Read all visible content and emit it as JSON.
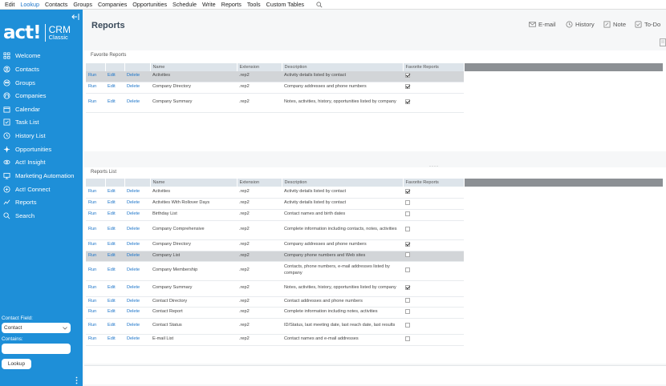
{
  "menu": [
    "Edit",
    "Lookup",
    "Contacts",
    "Groups",
    "Companies",
    "Opportunities",
    "Schedule",
    "Write",
    "Reports",
    "Tools",
    "Custom Tables"
  ],
  "menu_active": 1,
  "logo": {
    "act": "act!",
    "crm": "CRM",
    "classic": "Classic"
  },
  "nav": [
    {
      "label": "Welcome",
      "icon": "home-icon"
    },
    {
      "label": "Contacts",
      "icon": "contacts-icon"
    },
    {
      "label": "Groups",
      "icon": "groups-icon"
    },
    {
      "label": "Companies",
      "icon": "companies-icon"
    },
    {
      "label": "Calendar",
      "icon": "calendar-icon"
    },
    {
      "label": "Task List",
      "icon": "task-list-icon"
    },
    {
      "label": "History List",
      "icon": "history-icon"
    },
    {
      "label": "Opportunities",
      "icon": "opportunities-icon"
    },
    {
      "label": "Act! Insight",
      "icon": "insight-icon"
    },
    {
      "label": "Marketing Automation",
      "icon": "marketing-icon"
    },
    {
      "label": "Act! Connect",
      "icon": "connect-icon"
    },
    {
      "label": "Reports",
      "icon": "reports-icon"
    },
    {
      "label": "Search",
      "icon": "search-icon"
    }
  ],
  "lookup": {
    "field_label": "Contact Field:",
    "field_value": "Contact",
    "contains_label": "Contains:",
    "button": "Lookup"
  },
  "page_title": "Reports",
  "toolbar": {
    "email": "E-mail",
    "history": "History",
    "note": "Note",
    "todo": "To-Do"
  },
  "columns": {
    "c1": "",
    "c2": "",
    "c3": "",
    "name": "Name",
    "ext": "Extension",
    "desc": "Description",
    "fav": "Favorite Reports"
  },
  "favorite": {
    "title": "Favorite Reports",
    "rows": [
      {
        "run": "Run",
        "edit": "Edit",
        "del": "Delete",
        "name": "Activities",
        "ext": ".rep2",
        "desc": "Activity details listed by contact",
        "fav": true,
        "sel": true
      },
      {
        "run": "Run",
        "edit": "Edit",
        "del": "Delete",
        "name": "Company Directory",
        "ext": ".rep2",
        "desc": "Company addresses and phone numbers",
        "fav": true,
        "sel": false
      },
      {
        "run": "Run",
        "edit": "Edit",
        "del": "Delete",
        "name": "Company Summary",
        "ext": ".rep2",
        "desc": "Notes, activities, history, opportunities listed by company",
        "fav": true,
        "sel": false
      }
    ]
  },
  "reports": {
    "title": "Reports List",
    "rows": [
      {
        "run": "Run",
        "edit": "Edit",
        "del": "Delete",
        "name": "Activities",
        "ext": ".rep2",
        "desc": "Activity details listed by contact",
        "fav": true,
        "sel": false
      },
      {
        "run": "Run",
        "edit": "Edit",
        "del": "Delete",
        "name": "Activities With Rollover Days",
        "ext": ".rep2",
        "desc": "Activity details listed by contact",
        "fav": false,
        "sel": false
      },
      {
        "run": "Run",
        "edit": "Edit",
        "del": "Delete",
        "name": "Birthday List",
        "ext": ".rep2",
        "desc": "Contact names and birth dates",
        "fav": false,
        "sel": false
      },
      {
        "run": "Run",
        "edit": "Edit",
        "del": "Delete",
        "name": "Company Comprehensive",
        "ext": ".rep2",
        "desc": "Complete information including contacts, notes, activities",
        "fav": false,
        "sel": false
      },
      {
        "run": "Run",
        "edit": "Edit",
        "del": "Delete",
        "name": "Company Directory",
        "ext": ".rep2",
        "desc": "Company addresses and phone numbers",
        "fav": true,
        "sel": false
      },
      {
        "run": "Run",
        "edit": "Edit",
        "del": "Delete",
        "name": "Company List",
        "ext": ".rep2",
        "desc": "Company phone numbers and Web sites",
        "fav": false,
        "sel": true
      },
      {
        "run": "Run",
        "edit": "Edit",
        "del": "Delete",
        "name": "Company Membership",
        "ext": ".rep2",
        "desc": "Contacts, phone numbers, e-mail addresses listed by company",
        "fav": false,
        "sel": false
      },
      {
        "run": "Run",
        "edit": "Edit",
        "del": "Delete",
        "name": "Company Summary",
        "ext": ".rep2",
        "desc": "Notes, activities, history, opportunities listed by company",
        "fav": true,
        "sel": false
      },
      {
        "run": "Run",
        "edit": "Edit",
        "del": "Delete",
        "name": "Contact Directory",
        "ext": ".rep2",
        "desc": "Contact addresses and phone numbers",
        "fav": false,
        "sel": false
      },
      {
        "run": "Run",
        "edit": "Edit",
        "del": "Delete",
        "name": "Contact Report",
        "ext": ".rep2",
        "desc": "Complete information including notes, activities",
        "fav": false,
        "sel": false
      },
      {
        "run": "Run",
        "edit": "Edit",
        "del": "Delete",
        "name": "Contact Status",
        "ext": ".rep2",
        "desc": "ID/Status, last meeting date, last reach date, last results",
        "fav": false,
        "sel": false
      },
      {
        "run": "Run",
        "edit": "Edit",
        "del": "Delete",
        "name": "E-mail List",
        "ext": ".rep2",
        "desc": "Contact names and e-mail addresses",
        "fav": false,
        "sel": false
      }
    ]
  }
}
